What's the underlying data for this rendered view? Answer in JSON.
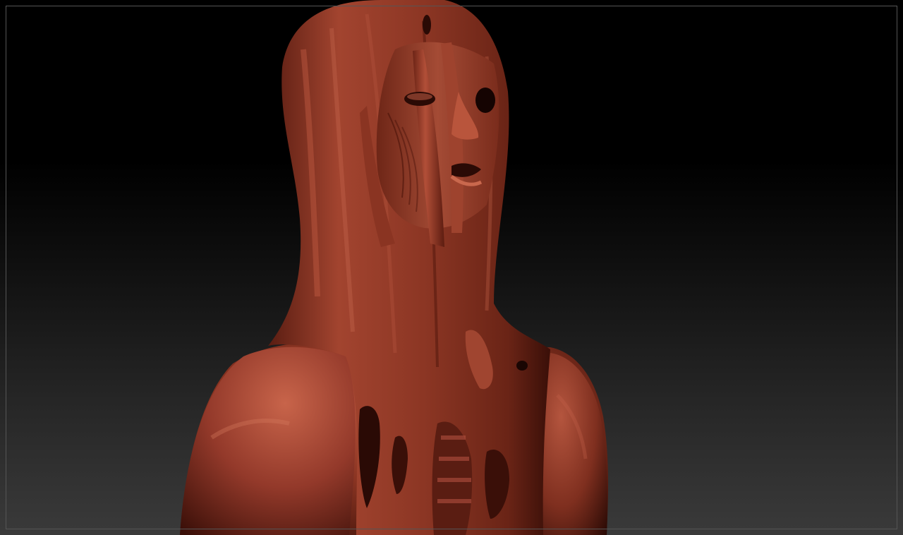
{
  "viewport": {
    "background_top": "#000000",
    "background_bottom": "#3a3a3a",
    "frame_color": "#555555"
  },
  "model": {
    "material_base": "#8a3422",
    "material_light": "#c45a3e",
    "material_dark": "#3a0f08",
    "material_shadow": "#1a0603"
  }
}
